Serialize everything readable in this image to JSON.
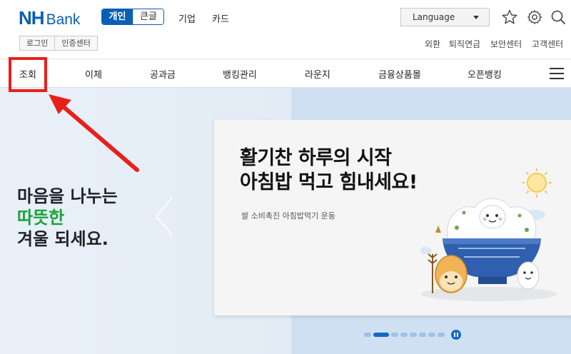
{
  "header": {
    "logo_nh": "NH",
    "logo_bank": "Bank",
    "segment": {
      "personal": "개인",
      "large_text": "큰글"
    },
    "topnav": [
      "기업",
      "카드"
    ],
    "language": {
      "label": "Language"
    },
    "icons": [
      "star-icon",
      "gear-icon",
      "search-icon"
    ],
    "sub_buttons": {
      "login": "로그인",
      "cert": "인증센터"
    },
    "util_links": [
      "외환",
      "퇴직연금",
      "보안센터",
      "고객센터"
    ]
  },
  "gnb": {
    "items": [
      "조회",
      "이체",
      "공과금",
      "뱅킹관리",
      "라운지",
      "금융상품몰",
      "오픈뱅킹"
    ],
    "menu_icon": "hamburger-icon"
  },
  "hero": {
    "line1": "마음을 나누는",
    "line2": "따뜻한",
    "line3": "겨울 되세요.",
    "card": {
      "title_line1": "활기찬 하루의 시작",
      "title_line2": "아침밥 먹고 힘내세요!",
      "subtitle": "쌀 소비촉진 아침밥먹기 운동"
    },
    "pagination": {
      "count": 8,
      "active_index": 1
    }
  },
  "colors": {
    "brand": "#0a5fb4",
    "highlight": "#e8201a",
    "green": "#1aa33b"
  }
}
